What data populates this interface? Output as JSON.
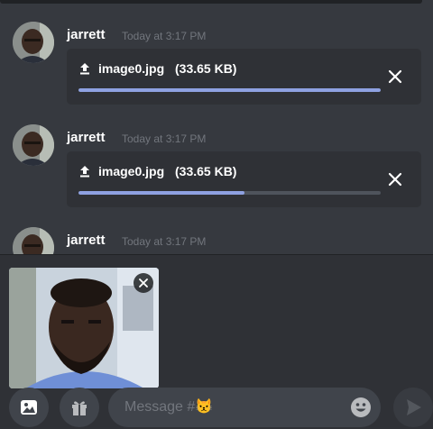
{
  "messages": [
    {
      "author": "jarrett",
      "timestamp": "Today at 3:17 PM",
      "upload": {
        "filename": "image0.jpg",
        "size": "(33.65 KB)",
        "progress": 1.0
      }
    },
    {
      "author": "jarrett",
      "timestamp": "Today at 3:17 PM",
      "upload": {
        "filename": "image0.jpg",
        "size": "(33.65 KB)",
        "progress": 0.55
      }
    },
    {
      "author": "jarrett",
      "timestamp": "Today at 3:17 PM"
    }
  ],
  "composer": {
    "placeholder": "Message #😾",
    "icons": [
      "image-icon",
      "gift-icon",
      "emoji-icon",
      "send-icon",
      "close-icon",
      "upload-icon"
    ]
  },
  "colors": {
    "background": "#36393f",
    "card": "#2f3136",
    "progress": "#8ea1e1",
    "muted": "#72767d"
  }
}
